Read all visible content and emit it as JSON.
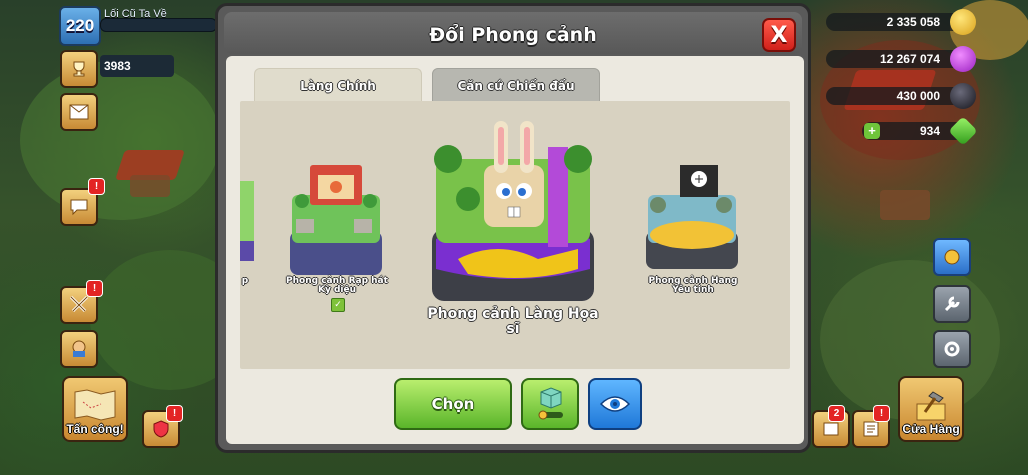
{
  "hud": {
    "level": "220",
    "player_name": "Lối Cũ Ta Về",
    "trophies": "3983",
    "attack_label": "Tấn công!",
    "shop_label": "Cửa Hàng",
    "badges": {
      "messages": "!",
      "clan": "!",
      "battle": "!",
      "builder": "!",
      "bottom_right_2": "2",
      "bottom_right_1": "!"
    }
  },
  "resources": {
    "gold": "2 335 058",
    "elixir": "12 267 074",
    "dark_elixir": "430 000",
    "gems": "934"
  },
  "modal": {
    "title": "Đổi Phong cảnh",
    "close_label": "X",
    "tabs": [
      {
        "label": "Làng Chính",
        "active": true
      },
      {
        "label": "Căn cứ Chiến đấu",
        "active": false
      }
    ],
    "sceneries": [
      {
        "label": "Phong cảnh Rạp hát Kỳ diệu",
        "owned": true
      },
      {
        "label": "Phong cảnh Làng Họa sĩ",
        "selected": true
      },
      {
        "label": "Phong cảnh Hang Yêu tinh"
      }
    ],
    "partial_left_label": "p",
    "choose_label": "Chọn",
    "check_glyph": "✓"
  },
  "colors": {
    "choose_green": "#5ab52a",
    "eye_blue": "#1f78d8",
    "close_red": "#d1201a",
    "modal_gray": "#5a5a5a"
  },
  "icons": [
    "close-icon",
    "eye-icon",
    "decoration-icon",
    "trophy-icon",
    "mail-icon",
    "chat-icon",
    "swords-icon",
    "gold-icon",
    "elixir-icon",
    "dark-elixir-icon",
    "gem-icon",
    "hammer-icon",
    "settings-icon"
  ]
}
